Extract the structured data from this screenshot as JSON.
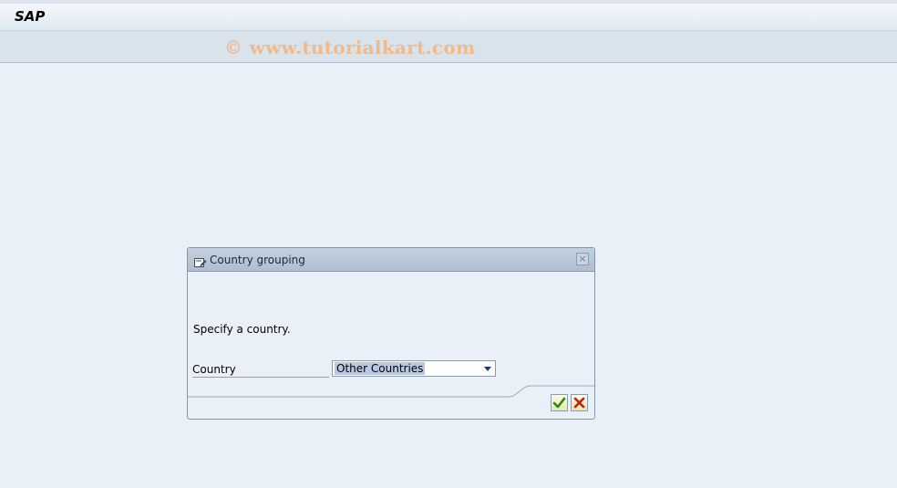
{
  "window": {
    "title": "SAP"
  },
  "watermark": {
    "text": "© www.tutorialkart.com"
  },
  "dialog": {
    "title": "Country grouping",
    "icon": "dialog-edit-icon",
    "message": "Specify a country.",
    "fields": [
      {
        "label": "Country",
        "value": "Other Countries"
      }
    ],
    "buttons": [
      {
        "name": "confirm",
        "icon": "check-icon"
      },
      {
        "name": "cancel",
        "icon": "cancel-x-icon"
      }
    ],
    "colors": {
      "header": "#aebdd3",
      "background": "#e9f0f7",
      "accent": "#1b3c78"
    }
  }
}
